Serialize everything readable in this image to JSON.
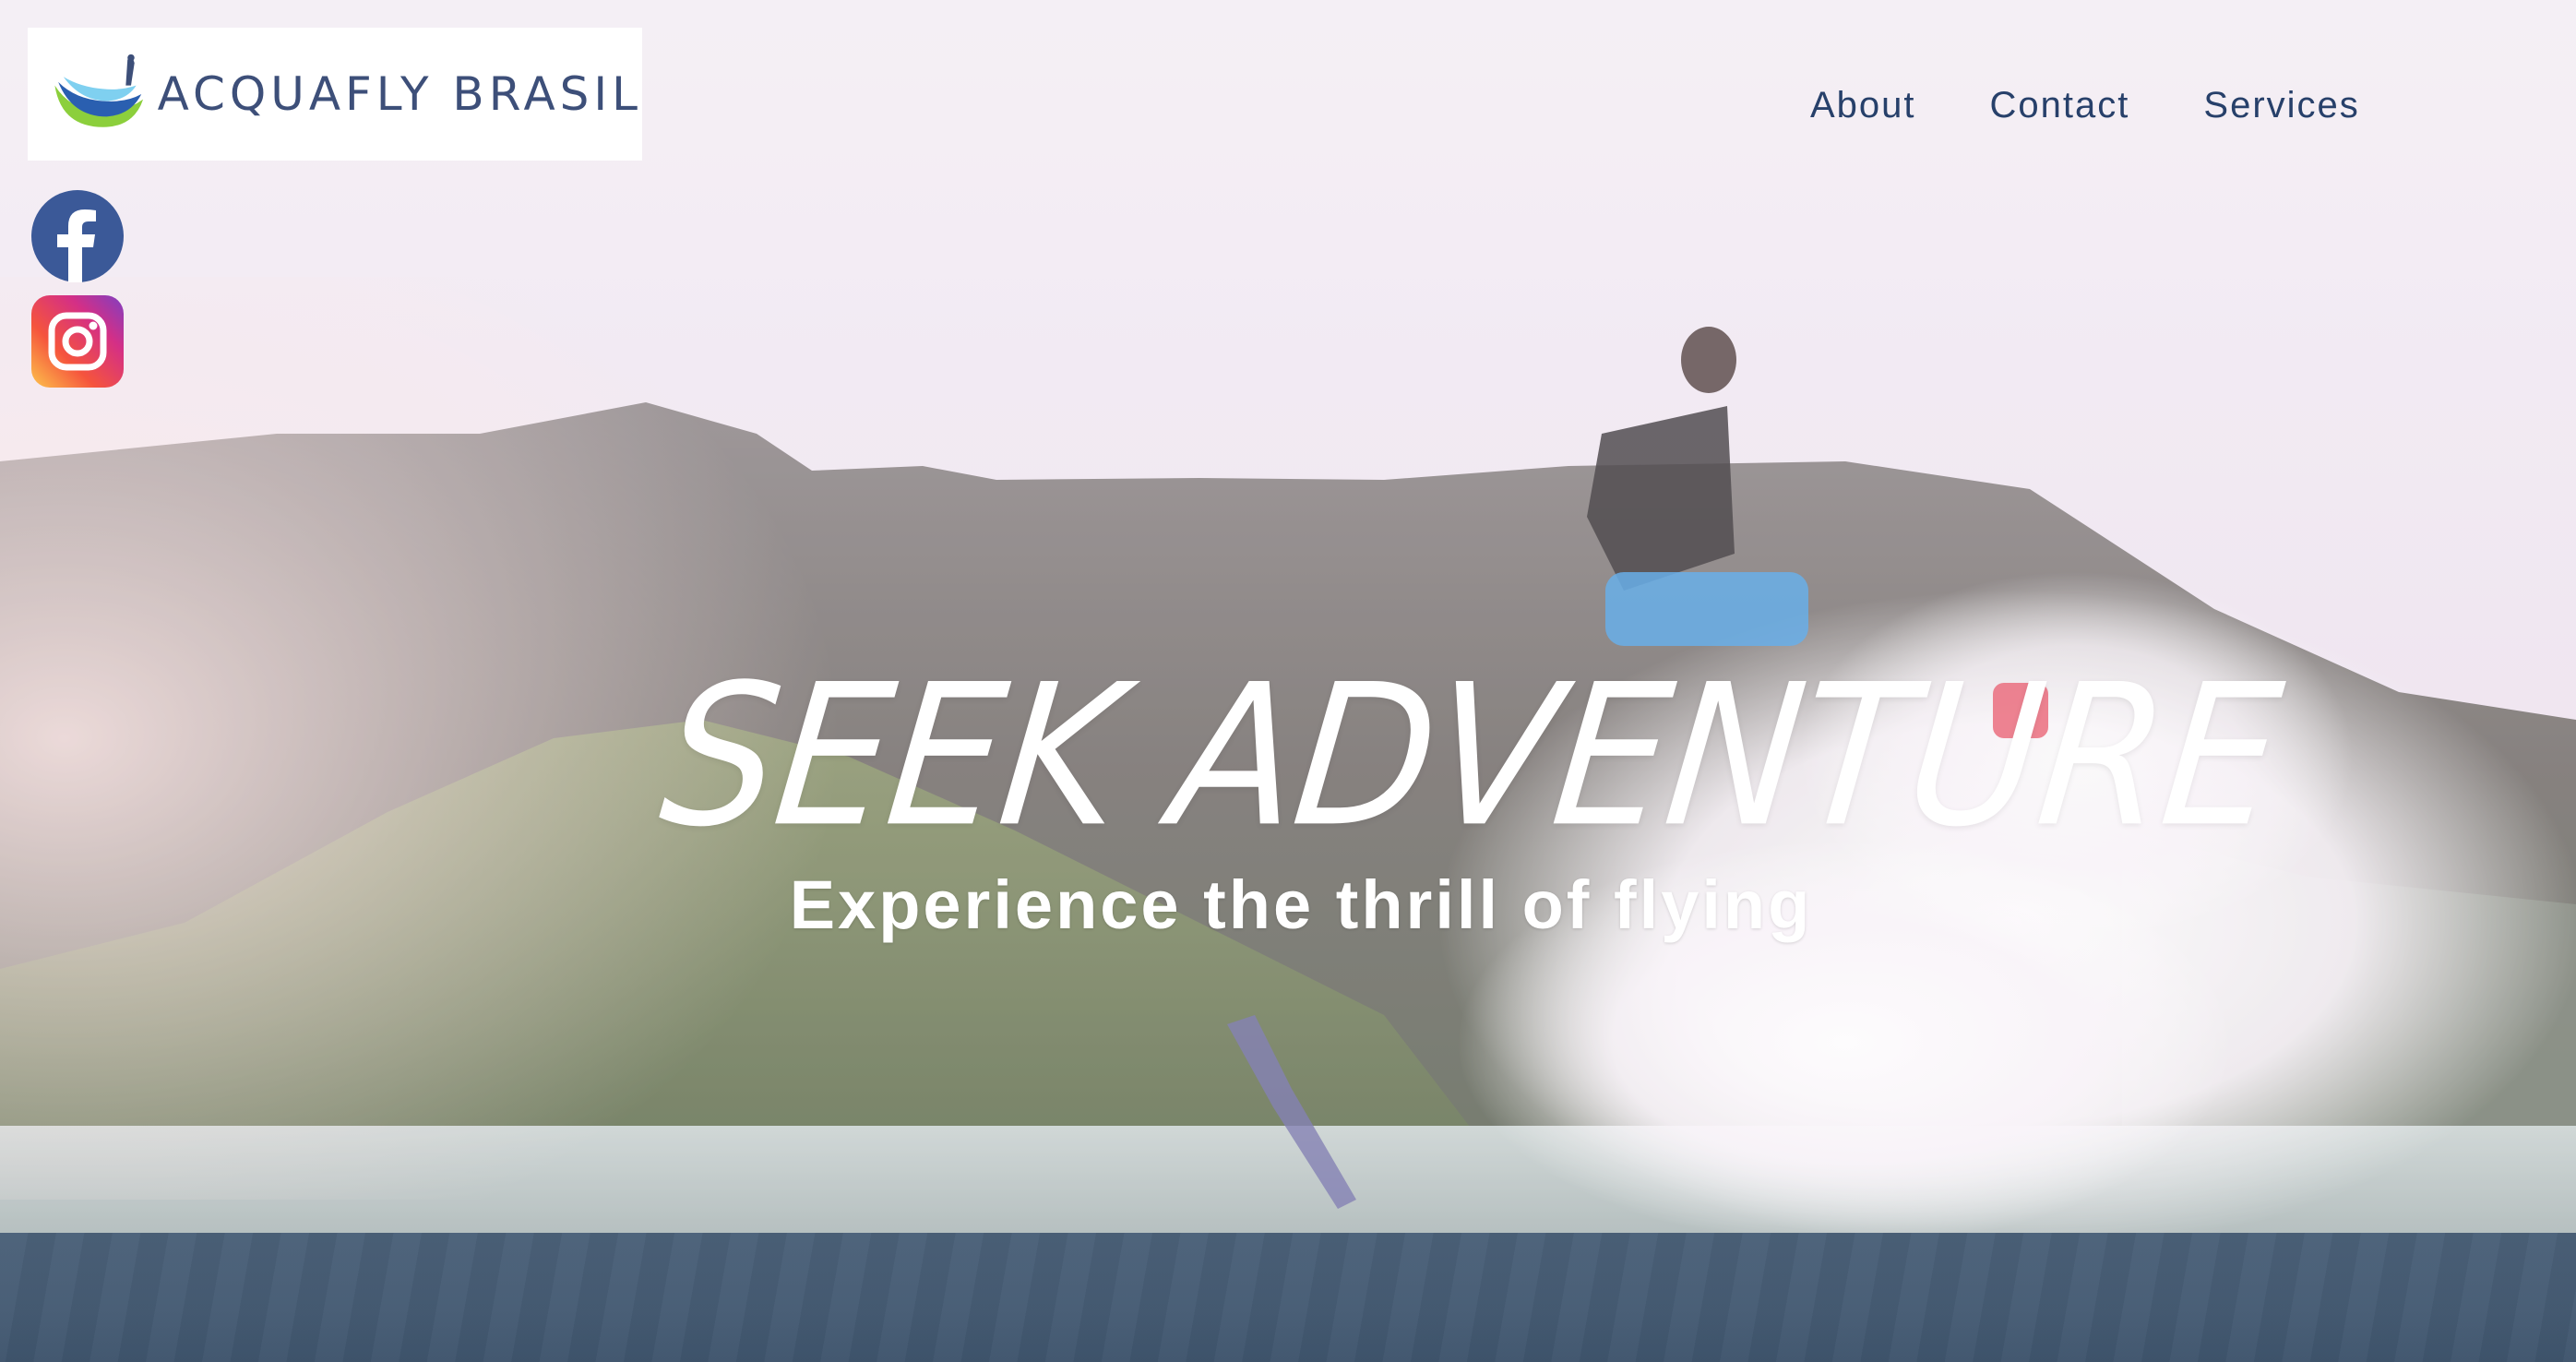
{
  "brand": {
    "name": "ACQUAFLY BRASIL",
    "logo_icon": "acquafly-logo-icon"
  },
  "nav": {
    "items": [
      {
        "label": "About"
      },
      {
        "label": "Contact"
      },
      {
        "label": "Services"
      }
    ]
  },
  "social": {
    "facebook_icon": "facebook-icon",
    "instagram_icon": "instagram-icon"
  },
  "hero": {
    "headline": "SEEK ADVENTURE",
    "tagline": "Experience the thrill of flying"
  },
  "colors": {
    "nav_text": "#27406a",
    "brand_text": "#3d4f79",
    "bottom_band": "#4a6078",
    "facebook": "#3b5998"
  }
}
